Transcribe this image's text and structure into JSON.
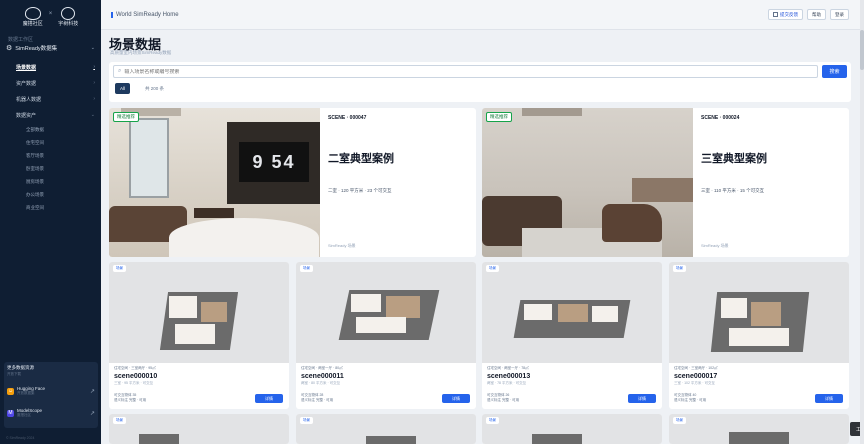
{
  "sidebar": {
    "logo_left": "魔搭社区",
    "logo_right": "宇树科技",
    "section_label": "数据工作区",
    "root_item": "SimReady数据集",
    "items": [
      {
        "label": "场景数据",
        "active": true
      },
      {
        "label": "资产数据",
        "active": false
      },
      {
        "label": "机器人数据",
        "active": false
      },
      {
        "label": "数据资产",
        "active": false
      }
    ],
    "subitems": [
      "全部数据",
      "住宅空间",
      "客厅场景",
      "卧室场景",
      "厨房场景",
      "办公场景",
      "商业空间"
    ],
    "footer": {
      "title": "更多数据资源",
      "subtitle": "开放下载",
      "links": [
        {
          "name": "Hugging Face",
          "desc": "开放数据集",
          "badge_color": "#f59e0b"
        },
        {
          "name": "ModelScope",
          "desc": "魔搭社区",
          "badge_color": "#4f46e5"
        }
      ]
    },
    "copyright": "© SimReady 2024"
  },
  "topbar": {
    "breadcrumb": "World SimReady Home",
    "actions": [
      "提交反馈",
      "帮助",
      "登录"
    ]
  },
  "page": {
    "title": "场景数据",
    "subtitle": "高质量室内场景SimReady数据"
  },
  "search": {
    "placeholder": "输入场景名称或编号搜索",
    "button": "搜索",
    "filter_chip": "All",
    "filter_text": "共 200 条"
  },
  "featured": [
    {
      "tag": "精选推荐",
      "code": "SCENE · 000047",
      "title": "二室典型案例",
      "meta": "二室 · 120 平方米 · 23 个可交互",
      "foot": "SimReady 场景"
    },
    {
      "tag": "精选推荐",
      "code": "SCENE · 000024",
      "title": "三室典型案例",
      "meta": "三室 · 110 平方米 · 15 个可交互",
      "foot": "SimReady 场景"
    }
  ],
  "cards": [
    {
      "badge": "场景",
      "meta": "住宅空间 · 三室两厅 · 95㎡",
      "name": "scene000010",
      "desc": "三室 · 95 平方米 · 可交互",
      "stats": [
        "可交互物体 35",
        "语义标注 完整 · 可用"
      ],
      "button": "详情"
    },
    {
      "badge": "场景",
      "meta": "住宅空间 · 两室一厅 · 80㎡",
      "name": "scene000011",
      "desc": "两室 · 80 平方米 · 可交互",
      "stats": [
        "可交互物体 28",
        "语义标注 完整 · 可用"
      ],
      "button": "详情"
    },
    {
      "badge": "场景",
      "meta": "住宅空间 · 两室一厅 · 78㎡",
      "name": "scene000013",
      "desc": "两室 · 78 平方米 · 可交互",
      "stats": [
        "可交互物体 26",
        "语义标注 完整 · 可用"
      ],
      "button": "详情"
    },
    {
      "badge": "场景",
      "meta": "住宅空间 · 三室两厅 · 102㎡",
      "name": "scene000017",
      "desc": "三室 · 102 平方米 · 可交互",
      "stats": [
        "可交互物体 40",
        "语义标注 完整 · 可用"
      ],
      "button": "详情"
    }
  ],
  "partial_cards": [
    {
      "badge": "场景"
    },
    {
      "badge": "场景"
    },
    {
      "badge": "场景"
    },
    {
      "badge": "场景"
    }
  ],
  "float_tool": "工具",
  "colors": {
    "accent": "#2563eb",
    "sidebar_bg": "#0f1e33",
    "tag_green": "#16a34a"
  }
}
